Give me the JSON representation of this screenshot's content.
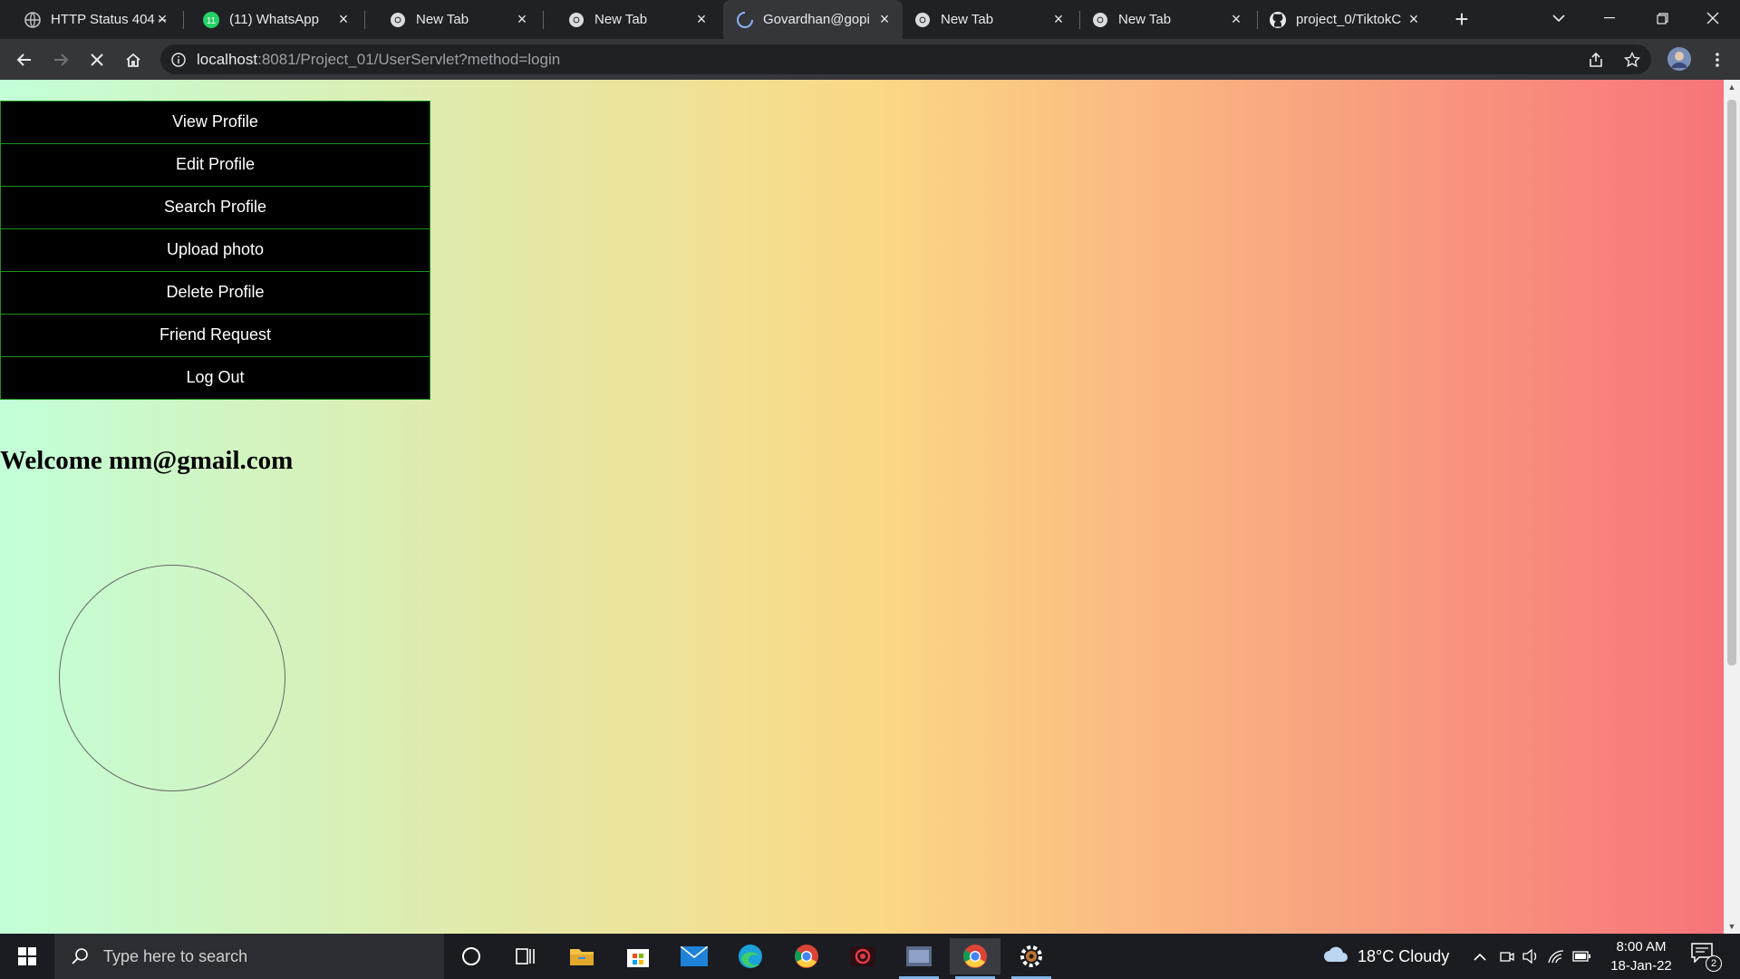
{
  "browser": {
    "tabs": [
      {
        "title": "HTTP Status 404 – ",
        "icon": "globe-icon",
        "active": false
      },
      {
        "title": "(11) WhatsApp",
        "icon": "whatsapp-icon",
        "active": false
      },
      {
        "title": "New Tab",
        "icon": "chrome-icon",
        "active": false
      },
      {
        "title": "New Tab",
        "icon": "chrome-icon",
        "active": false
      },
      {
        "title": "Govardhan@gopi",
        "icon": "loading-spinner-icon",
        "active": true
      },
      {
        "title": "New Tab",
        "icon": "chrome-icon",
        "active": false
      },
      {
        "title": "New Tab",
        "icon": "chrome-icon",
        "active": false
      },
      {
        "title": "project_0/TiktokC",
        "icon": "github-icon",
        "active": false
      }
    ],
    "url_host": "localhost",
    "url_rest": ":8081/Project_01/UserServlet?method=login"
  },
  "menu": {
    "items": [
      {
        "label": "View Profile"
      },
      {
        "label": "Edit Profile"
      },
      {
        "label": "Search Profile"
      },
      {
        "label": "Upload photo"
      },
      {
        "label": "Delete Profile"
      },
      {
        "label": "Friend Request"
      },
      {
        "label": "Log Out"
      }
    ]
  },
  "welcome": {
    "text": "Welcome mm@gmail.com"
  },
  "taskbar": {
    "search_placeholder": "Type here to search",
    "weather": "18°C  Cloudy",
    "time": "8:00 AM",
    "date": "18-Jan-22",
    "notification_count": "2"
  },
  "colors": {
    "gradient_start": "#c2ffd8",
    "gradient_mid": "#fbd985",
    "gradient_end": "#f7727a",
    "menu_bg": "#000000",
    "menu_border": "#1f8f1f"
  }
}
